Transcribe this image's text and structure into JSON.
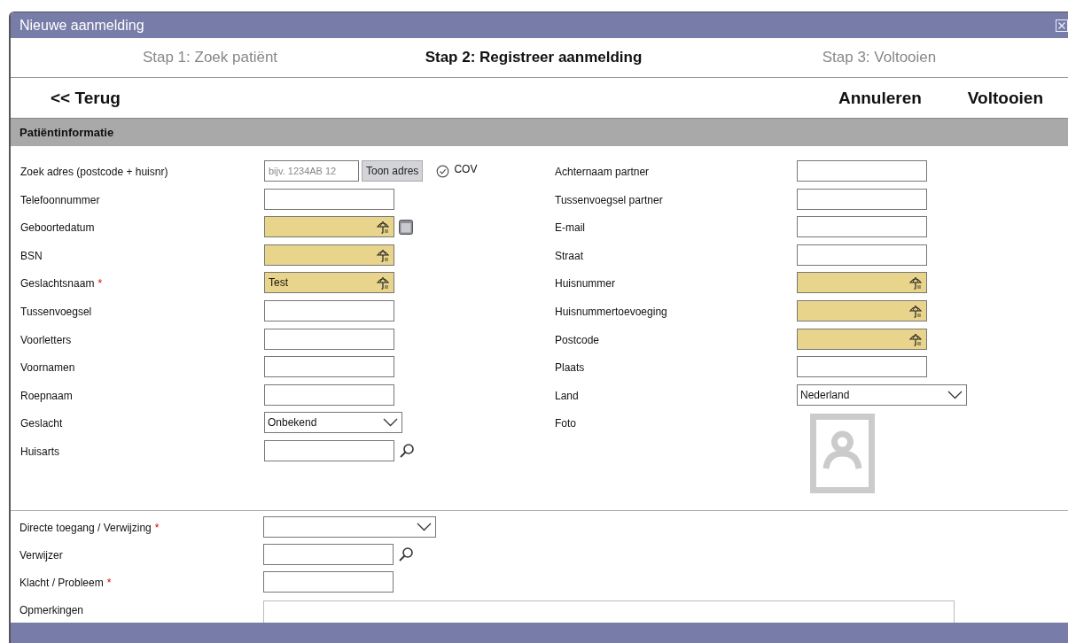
{
  "window": {
    "title": "Nieuwe aanmelding"
  },
  "steps": [
    {
      "label": "Stap 1: Zoek patiënt",
      "selected": false
    },
    {
      "label": "Stap 2: Registreer aanmelding",
      "selected": true
    },
    {
      "label": "Stap 3: Voltooien",
      "selected": false
    }
  ],
  "nav": {
    "back": "<< Terug",
    "actions": [
      "Annuleren",
      "Voltooien"
    ]
  },
  "section": {
    "title": "Patiëntinformatie"
  },
  "left_fields": [
    {
      "kind": "address",
      "label": "Zoek adres (postcode + huisnr)",
      "placeholder": "bijv. 1234AB 12",
      "button": "Toon adres",
      "check_label": "COV",
      "highlighted": false
    },
    {
      "kind": "text",
      "label": "Telefoonnummer",
      "highlighted": false
    },
    {
      "kind": "date",
      "label": "Geboortedatum",
      "highlighted": true
    },
    {
      "kind": "text",
      "label": "BSN",
      "highlighted": true
    },
    {
      "kind": "text",
      "label": "Geslachtsnaam",
      "required_mark": "*",
      "value": "Test",
      "highlighted": true
    },
    {
      "kind": "text",
      "label": "Tussenvoegsel",
      "highlighted": false
    },
    {
      "kind": "text",
      "label": "Voorletters",
      "highlighted": false
    },
    {
      "kind": "text",
      "label": "Voornamen",
      "highlighted": false
    },
    {
      "kind": "text",
      "label": "Roepnaam",
      "highlighted": false
    },
    {
      "kind": "select",
      "label": "Geslacht",
      "value": "Onbekend",
      "highlighted": false
    },
    {
      "kind": "lookup",
      "label": "Huisarts",
      "highlighted": false
    }
  ],
  "right_fields": [
    {
      "kind": "text",
      "label": "Achternaam partner",
      "highlighted": false
    },
    {
      "kind": "text",
      "label": "Tussenvoegsel partner",
      "highlighted": false
    },
    {
      "kind": "text",
      "label": "E-mail",
      "highlighted": false
    },
    {
      "kind": "text",
      "label": "Straat",
      "highlighted": false
    },
    {
      "kind": "text",
      "label": "Huisnummer",
      "highlighted": true
    },
    {
      "kind": "text",
      "label": "Huisnummertoevoeging",
      "highlighted": true
    },
    {
      "kind": "text",
      "label": "Postcode",
      "highlighted": true
    },
    {
      "kind": "text",
      "label": "Plaats",
      "highlighted": false
    },
    {
      "kind": "select",
      "label": "Land",
      "value": "Nederland",
      "highlighted": false
    },
    {
      "kind": "photo",
      "label": "Foto"
    }
  ],
  "referral_fields": [
    {
      "kind": "select",
      "label": "Directe toegang / Verwijzing",
      "required_mark": "*",
      "highlighted": false
    },
    {
      "kind": "lookup",
      "label": "Verwijzer",
      "highlighted": false
    },
    {
      "kind": "text",
      "label": "Klacht / Probleem",
      "required_mark": "*",
      "highlighted": false
    },
    {
      "kind": "textarea",
      "label": "Opmerkingen",
      "highlighted": false
    }
  ]
}
